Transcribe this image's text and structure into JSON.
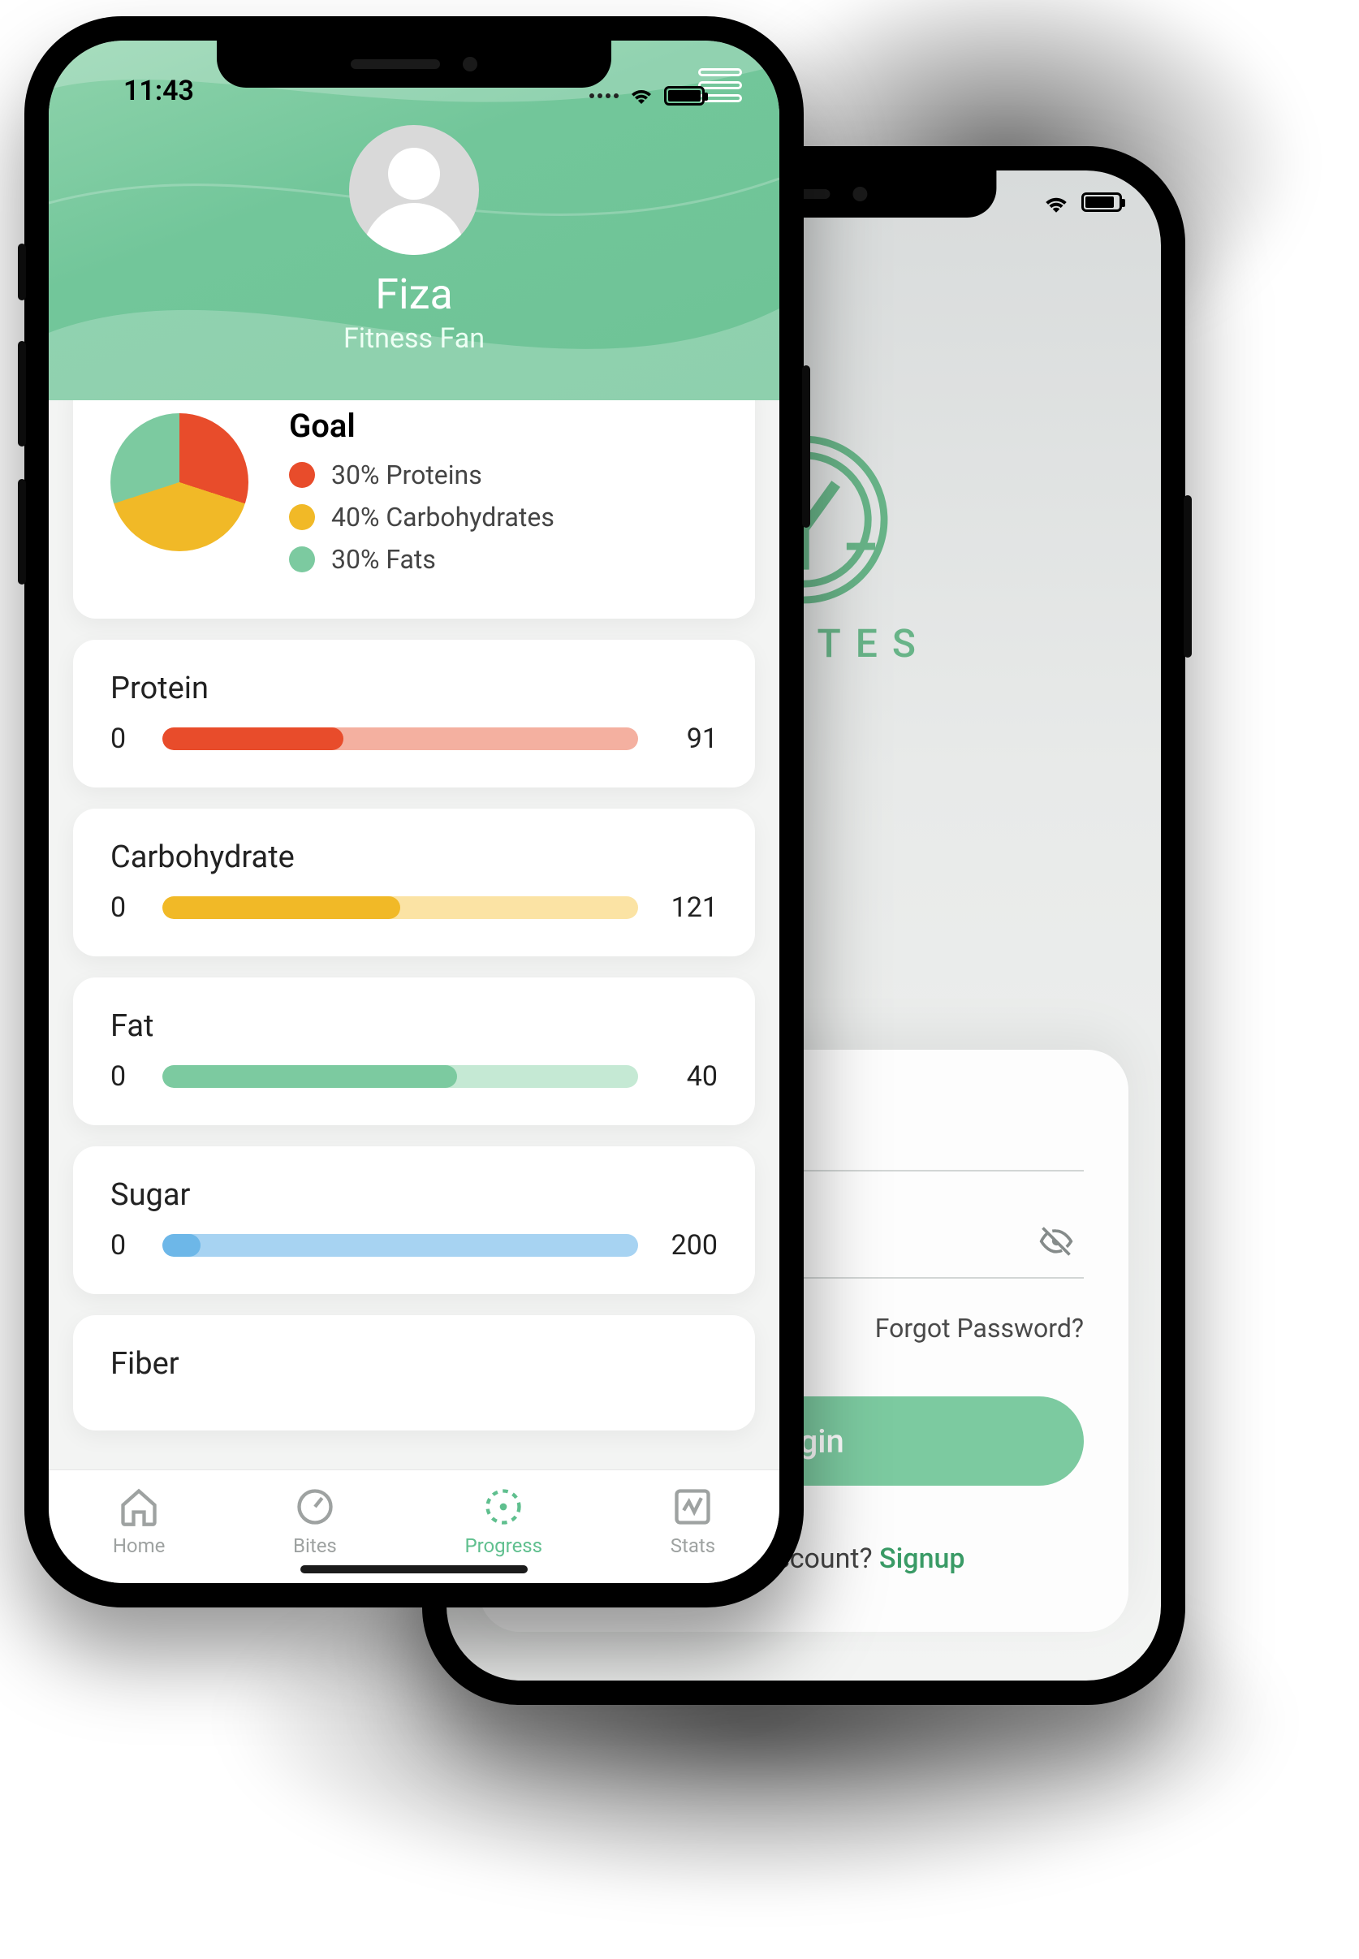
{
  "statusbar": {
    "time": "11:43"
  },
  "header": {
    "username": "Fiza",
    "tagline": "Fitness Fan"
  },
  "goal": {
    "title": "Goal",
    "items": [
      {
        "label": "30% Proteins",
        "color": "#e84c2b"
      },
      {
        "label": "40% Carbohydrates",
        "color": "#f1b927"
      },
      {
        "label": "30% Fats",
        "color": "#7ccaa0"
      }
    ]
  },
  "nutrients": [
    {
      "name": "Protein",
      "min": "0",
      "max": "91",
      "fill_pct": 38,
      "bg": "#f4b0a0",
      "fg": "#e84c2b"
    },
    {
      "name": "Carbohydrate",
      "min": "0",
      "max": "121",
      "fill_pct": 50,
      "bg": "#fbe3a4",
      "fg": "#f1b927"
    },
    {
      "name": "Fat",
      "min": "0",
      "max": "40",
      "fill_pct": 62,
      "bg": "#c5e9d4",
      "fg": "#7ccaa0"
    },
    {
      "name": "Sugar",
      "min": "0",
      "max": "200",
      "fill_pct": 8,
      "bg": "#a7d3f2",
      "fg": "#6db7e8"
    }
  ],
  "nutrient_fiber_name": "Fiber",
  "tabs": {
    "home": "Home",
    "bites": "Bites",
    "progress": "Progress",
    "stats": "Stats"
  },
  "login": {
    "brand": "LDBITES",
    "forgot": "Forgot Password?",
    "button": "Login",
    "signup_prompt": "t have an account? ",
    "signup_link": "Signup"
  },
  "chart_data": {
    "type": "pie",
    "title": "Goal",
    "series": [
      {
        "name": "Proteins",
        "value": 30,
        "color": "#e84c2b"
      },
      {
        "name": "Carbohydrates",
        "value": 40,
        "color": "#f1b927"
      },
      {
        "name": "Fats",
        "value": 30,
        "color": "#7ccaa0"
      }
    ]
  }
}
